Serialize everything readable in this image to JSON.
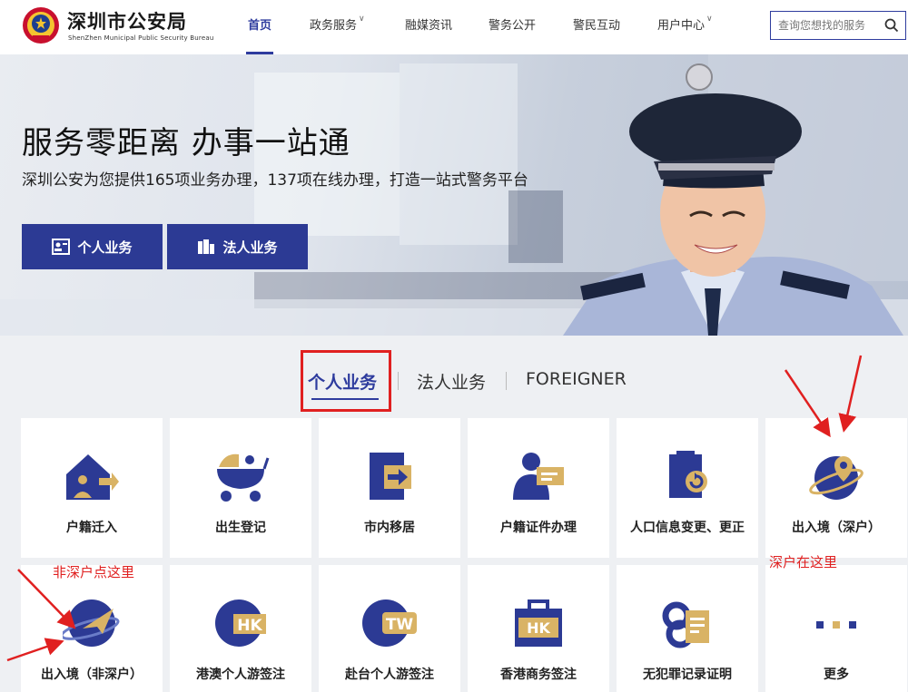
{
  "header": {
    "brand_cn": "深圳市公安局",
    "brand_en": "ShenZhen Municipal Public Security Bureau",
    "nav": [
      {
        "label": "首页",
        "active": true,
        "caret": ""
      },
      {
        "label": "政务服务",
        "active": false,
        "caret": "∨"
      },
      {
        "label": "融媒资讯",
        "active": false,
        "caret": ""
      },
      {
        "label": "警务公开",
        "active": false,
        "caret": ""
      },
      {
        "label": "警民互动",
        "active": false,
        "caret": ""
      },
      {
        "label": "用户中心",
        "active": false,
        "caret": "∨"
      }
    ],
    "search_placeholder": "查询您想找的服务"
  },
  "hero": {
    "title": "服务零距离 办事一站通",
    "subtitle": "深圳公安为您提供165项业务办理，137项在线办理，打造一站式警务平台",
    "buttons": [
      "个人业务",
      "法人业务"
    ]
  },
  "tabs": [
    "个人业务",
    "法人业务",
    "FOREIGNER"
  ],
  "services_row1": [
    "户籍迁入",
    "出生登记",
    "市内移居",
    "户籍证件办理",
    "人口信息变更、更正",
    "出入境（深户）"
  ],
  "services_row2": [
    "出入境（非深户）",
    "港澳个人游签注",
    "赴台个人游签注",
    "香港商务签注",
    "无犯罪记录证明",
    "更多"
  ],
  "annotations": {
    "left": "非深户点这里",
    "right": "深户在这里"
  },
  "colors": {
    "primary": "#2c3a94",
    "accent_gold": "#d9b365",
    "annotation": "#e02020"
  }
}
